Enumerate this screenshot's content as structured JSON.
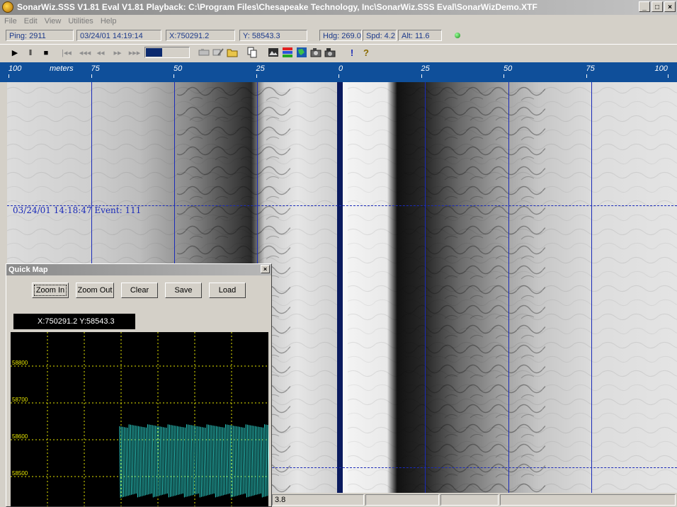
{
  "window": {
    "title": "SonarWiz.SSS V1.81 Eval V1.81 Playback: C:\\Program Files\\Chesapeake Technology, Inc\\SonarWiz.SSS Eval\\SonarWizDemo.XTF",
    "minimize": "_",
    "maximize": "□",
    "close": "×"
  },
  "menu": [
    "File",
    "Edit",
    "View",
    "Utilities",
    "Help"
  ],
  "status": {
    "ping": "Ping: 2911",
    "datetime": "03/24/01 14:19:14",
    "x": "X:750291.2",
    "y": "Y: 58543.3",
    "hdg": "Hdg: 269.0",
    "spd": "Spd: 4.2",
    "alt": "Alt: 11.6"
  },
  "toolbar": {
    "play": "▶",
    "pause": "‖",
    "stop": "■",
    "first": "|◂◂",
    "rewind_fast": "◂◂◂",
    "rewind": "◂◂",
    "forward": "▸▸",
    "forward_fast": "▸▸▸",
    "progress": 0.38,
    "exclaim": "!",
    "help": "?"
  },
  "ruler": {
    "unit": "meters",
    "ticks": [
      {
        "label": "100",
        "pos": 0.0
      },
      {
        "label": "75",
        "pos": 0.125
      },
      {
        "label": "50",
        "pos": 0.25
      },
      {
        "label": "25",
        "pos": 0.375
      },
      {
        "label": "0",
        "pos": 0.5
      },
      {
        "label": "25",
        "pos": 0.625
      },
      {
        "label": "50",
        "pos": 0.75
      },
      {
        "label": "75",
        "pos": 0.875
      },
      {
        "label": "100",
        "pos": 1.0
      }
    ]
  },
  "sonar": {
    "event_label": "03/24/01 14:18:47 Event: 111"
  },
  "bottom_status": {
    "value": "3.8"
  },
  "quick_map": {
    "title": "Quick Map",
    "close": "×",
    "buttons": {
      "zoom_in": "Zoom In",
      "zoom_out": "Zoom Out",
      "clear": "Clear",
      "save": "Save",
      "load": "Load"
    },
    "coords": "X:750291.2 Y:58543.3",
    "y_ticks": [
      "58800",
      "58700",
      "58600",
      "58500"
    ]
  }
}
